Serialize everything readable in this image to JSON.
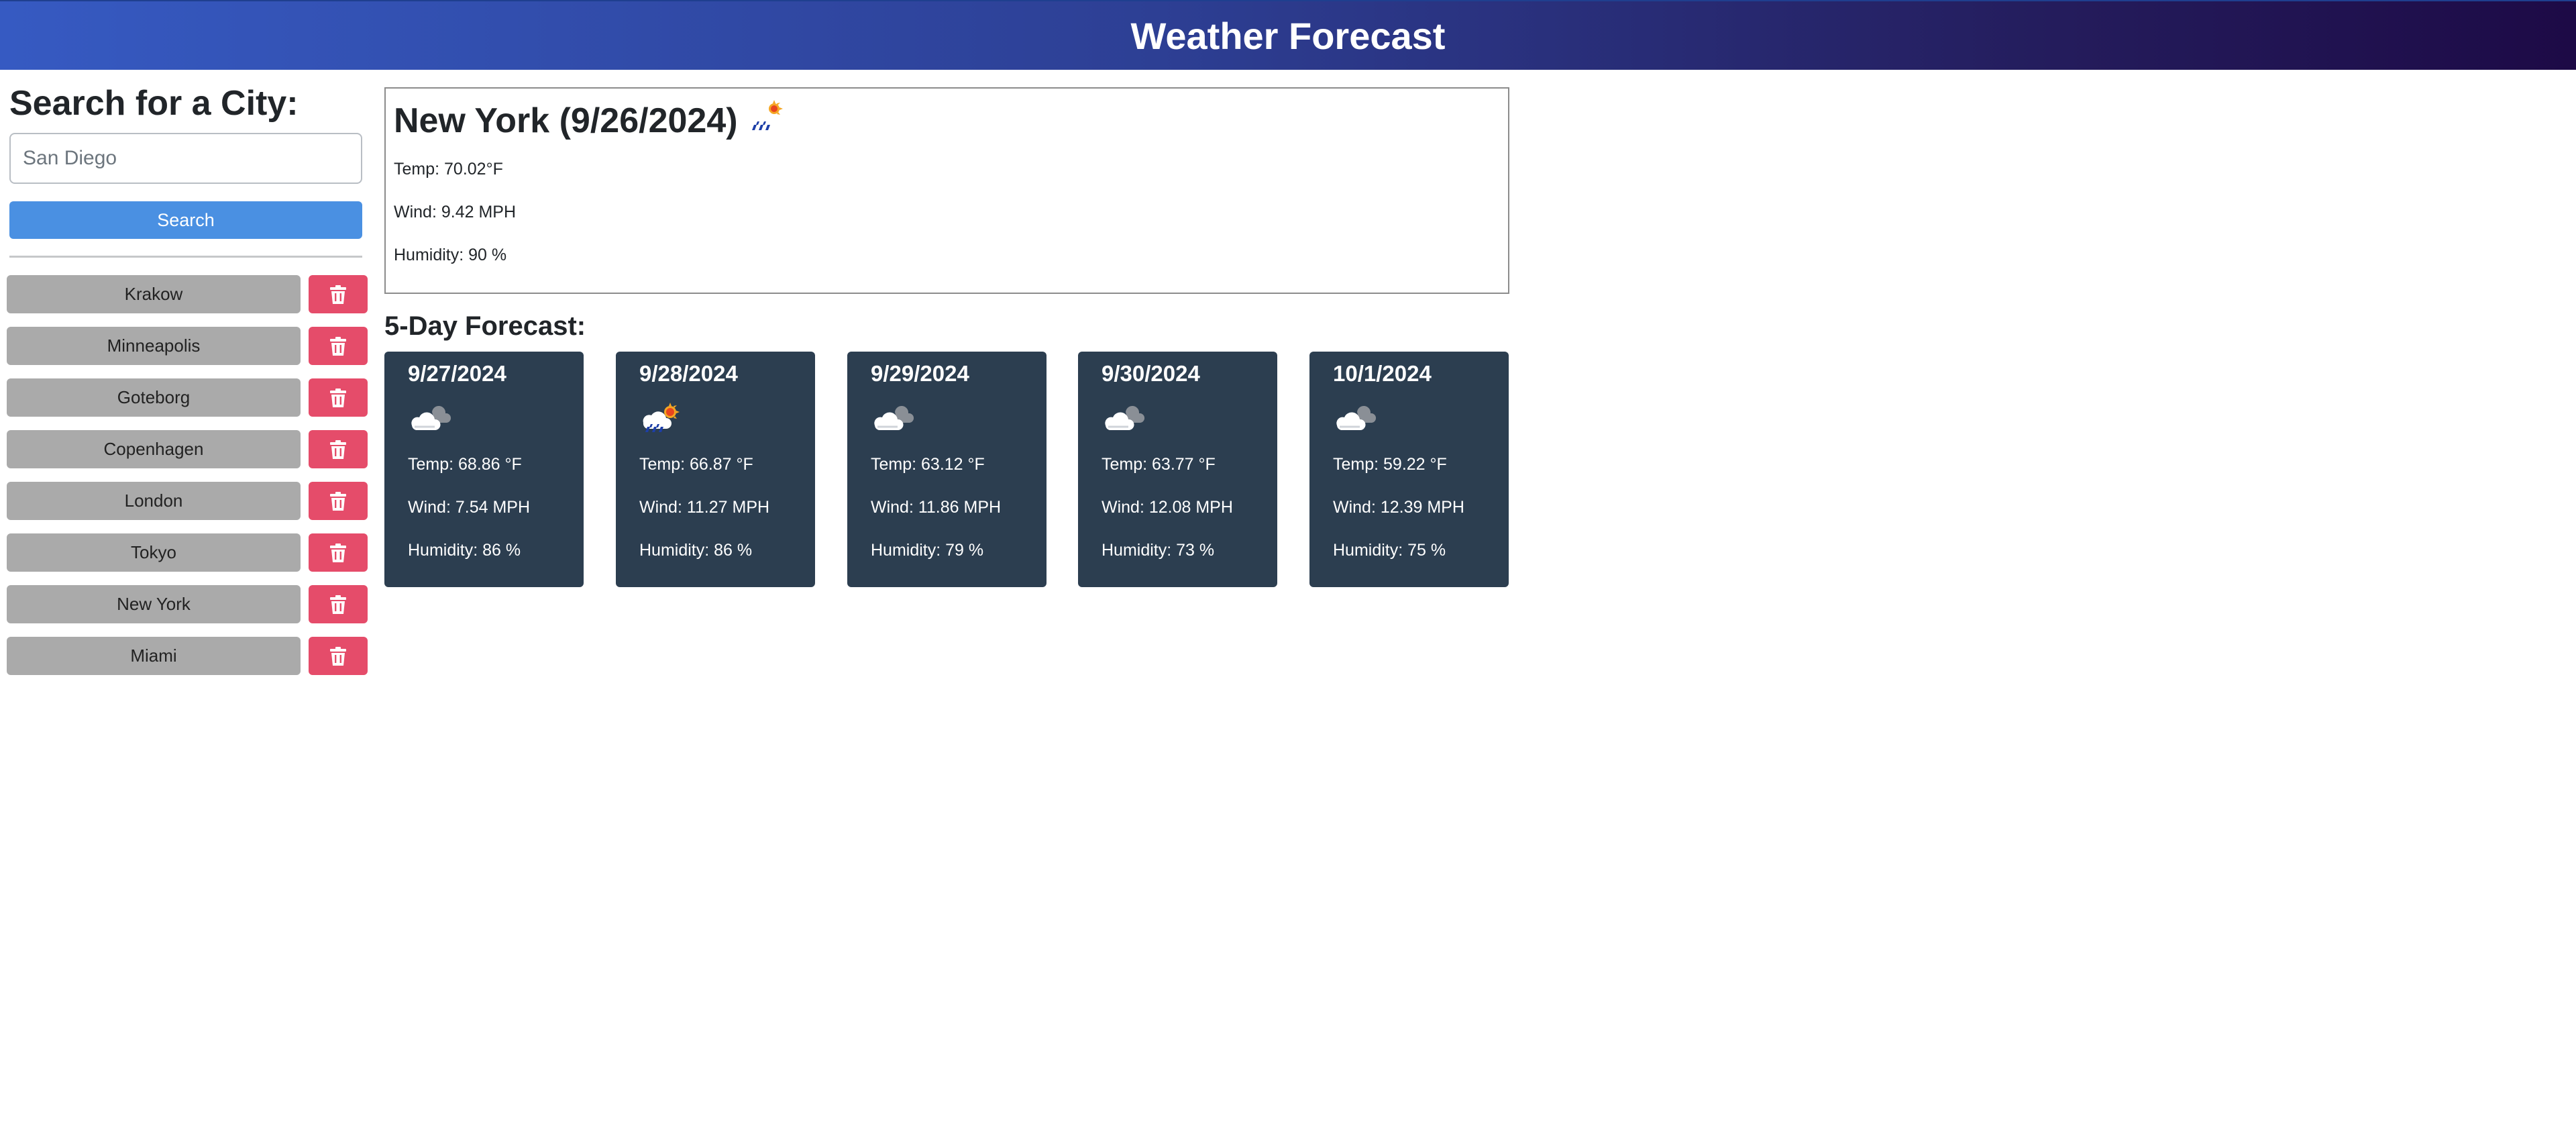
{
  "header": {
    "title": "Weather Forecast"
  },
  "search": {
    "heading": "Search for a City:",
    "placeholder": "San Diego",
    "button_label": "Search"
  },
  "history": [
    {
      "city": "Krakow"
    },
    {
      "city": "Minneapolis"
    },
    {
      "city": "Goteborg"
    },
    {
      "city": "Copenhagen"
    },
    {
      "city": "London"
    },
    {
      "city": "Tokyo"
    },
    {
      "city": "New York"
    },
    {
      "city": "Miami"
    }
  ],
  "current": {
    "title": "New York (9/26/2024)",
    "icon": "rain-sun-icon",
    "temp": "Temp: 70.02°F",
    "wind": "Wind: 9.42 MPH",
    "humidity": "Humidity: 90 %"
  },
  "forecast": {
    "heading": "5-Day Forecast:",
    "days": [
      {
        "date": "9/27/2024",
        "icon": "cloud-icon",
        "temp": "Temp: 68.86 °F",
        "wind": "Wind: 7.54 MPH",
        "humidity": "Humidity: 86 %"
      },
      {
        "date": "9/28/2024",
        "icon": "rain-sun-icon",
        "temp": "Temp: 66.87 °F",
        "wind": "Wind: 11.27 MPH",
        "humidity": "Humidity: 86 %"
      },
      {
        "date": "9/29/2024",
        "icon": "cloud-icon",
        "temp": "Temp: 63.12 °F",
        "wind": "Wind: 11.86 MPH",
        "humidity": "Humidity: 79 %"
      },
      {
        "date": "9/30/2024",
        "icon": "cloud-icon",
        "temp": "Temp: 63.77 °F",
        "wind": "Wind: 12.08 MPH",
        "humidity": "Humidity: 73 %"
      },
      {
        "date": "10/1/2024",
        "icon": "cloud-icon",
        "temp": "Temp: 59.22 °F",
        "wind": "Wind: 12.39 MPH",
        "humidity": "Humidity: 75 %"
      }
    ]
  },
  "colors": {
    "header_gradient_start": "#365ac2",
    "header_gradient_end": "#1d0a46",
    "search_button": "#4a90e2",
    "city_button": "#aaaaaa",
    "delete_button": "#e54c6a",
    "forecast_card": "#2c3e50"
  }
}
